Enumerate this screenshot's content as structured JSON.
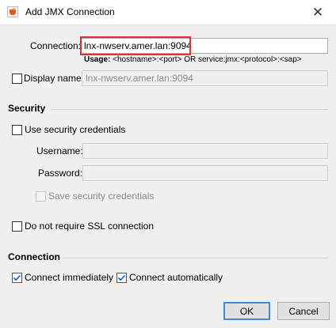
{
  "window": {
    "title": "Add JMX Connection",
    "close_icon": "close-icon"
  },
  "connection": {
    "label": "Connection:",
    "value": "lnx-nwserv.amer.lan:9094",
    "usage_label": "Usage:",
    "usage_text": "<hostname>:<port> OR service:jmx:<protocol>:<sap>"
  },
  "display_name": {
    "label": "Display name:",
    "checked": false,
    "placeholder": "lnx-nwserv.amer.lan:9094"
  },
  "security": {
    "title": "Security",
    "use_credentials_label": "Use security credentials",
    "use_credentials_checked": false,
    "username_label": "Username:",
    "username_value": "",
    "password_label": "Password:",
    "password_value": "",
    "save_credentials_label": "Save security credentials",
    "save_credentials_checked": false,
    "no_ssl_label": "Do not require SSL connection",
    "no_ssl_checked": false
  },
  "connection_options": {
    "title": "Connection",
    "connect_immediately_label": "Connect immediately",
    "connect_immediately_checked": true,
    "connect_automatically_label": "Connect automatically",
    "connect_automatically_checked": true
  },
  "buttons": {
    "ok": "OK",
    "cancel": "Cancel"
  },
  "colors": {
    "highlight": "#e0302f",
    "check_accent": "#1a5fb4",
    "primary_button_border": "#3c8de0"
  }
}
